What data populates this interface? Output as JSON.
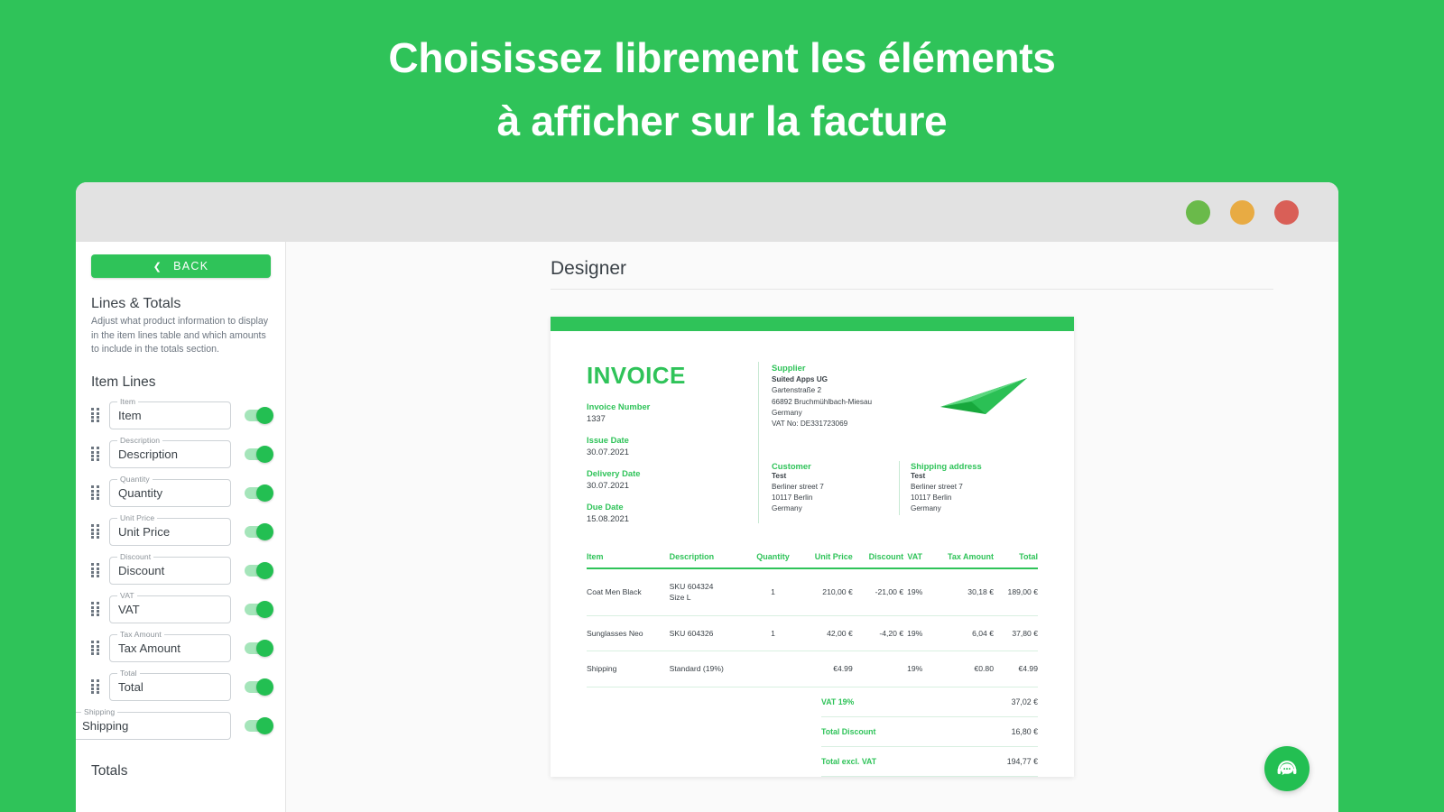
{
  "hero": {
    "line1": "Choisissez librement les éléments",
    "line2": "à afficher sur la facture"
  },
  "colors": {
    "brand_green": "#2fc359",
    "toggle_on": "#23bf52",
    "dot_green": "#6aba4a",
    "dot_amber": "#e8ab43",
    "dot_red": "#d95f57"
  },
  "window": {
    "dots": [
      "dot-green",
      "dot-amber",
      "dot-red"
    ]
  },
  "sidebar": {
    "back_label": "BACK",
    "back_icon": "chevron-left-icon",
    "panel_title": "Lines & Totals",
    "panel_desc": "Adjust what product information to display in the item lines table and which amounts to include in the totals section.",
    "section_title": "Item Lines",
    "totals_title": "Totals",
    "fields": [
      {
        "legend": "Item",
        "value": "Item",
        "toggle": "on",
        "draggable": true
      },
      {
        "legend": "Description",
        "value": "Description",
        "toggle": "on",
        "draggable": true
      },
      {
        "legend": "Quantity",
        "value": "Quantity",
        "toggle": "on",
        "draggable": true
      },
      {
        "legend": "Unit Price",
        "value": "Unit Price",
        "toggle": "on",
        "draggable": true
      },
      {
        "legend": "Discount",
        "value": "Discount",
        "toggle": "on",
        "draggable": true
      },
      {
        "legend": "VAT",
        "value": "VAT",
        "toggle": "on",
        "draggable": true
      },
      {
        "legend": "Tax Amount",
        "value": "Tax Amount",
        "toggle": "on",
        "draggable": true
      },
      {
        "legend": "Total",
        "value": "Total",
        "toggle": "on",
        "draggable": true
      },
      {
        "legend": "Shipping",
        "value": "Shipping",
        "toggle": "on",
        "draggable": false
      }
    ]
  },
  "main": {
    "designer_title": "Designer"
  },
  "invoice": {
    "title": "INVOICE",
    "meta": [
      {
        "label": "Invoice Number",
        "value": "1337"
      },
      {
        "label": "Issue Date",
        "value": "30.07.2021"
      },
      {
        "label": "Delivery Date",
        "value": "30.07.2021"
      },
      {
        "label": "Due Date",
        "value": "15.08.2021"
      }
    ],
    "supplier": {
      "label": "Supplier",
      "name": "Suited Apps UG",
      "lines": [
        "Gartenstraße 2",
        "66892 Bruchmühlbach-Miesau",
        "Germany",
        "VAT No: DE331723069"
      ]
    },
    "customer": {
      "label": "Customer",
      "name": "Test",
      "lines": [
        "Berliner street 7",
        "10117 Berlin",
        "Germany"
      ]
    },
    "shipping_address": {
      "label": "Shipping address",
      "name": "Test",
      "lines": [
        "Berliner street 7",
        "10117 Berlin",
        "Germany"
      ]
    },
    "logo_icon": "paper-plane-logo",
    "table": {
      "headers": [
        "Item",
        "Description",
        "Quantity",
        "Unit Price",
        "Discount",
        "VAT",
        "Tax Amount",
        "Total"
      ],
      "rows": [
        {
          "item": "Coat Men Black",
          "description": "SKU 604324",
          "description2": "Size L",
          "quantity": "1",
          "unit_price": "210,00 €",
          "discount": "-21,00 €",
          "vat": "19%",
          "tax_amount": "30,18 €",
          "total": "189,00 €"
        },
        {
          "item": "Sunglasses Neo",
          "description": "SKU 604326",
          "description2": "",
          "quantity": "1",
          "unit_price": "42,00 €",
          "discount": "-4,20 €",
          "vat": "19%",
          "tax_amount": "6,04 €",
          "total": "37,80 €"
        },
        {
          "item": "Shipping",
          "description": "Standard (19%)",
          "description2": "",
          "quantity": "",
          "unit_price": "€4.99",
          "discount": "",
          "vat": "19%",
          "tax_amount": "€0.80",
          "total": "€4.99"
        }
      ]
    },
    "totals": [
      {
        "label": "VAT 19%",
        "value": "37,02 €"
      },
      {
        "label": "Total Discount",
        "value": "16,80 €"
      },
      {
        "label": "Total excl. VAT",
        "value": "194,77 €"
      }
    ]
  },
  "chat": {
    "icon": "headset-chat-icon"
  }
}
